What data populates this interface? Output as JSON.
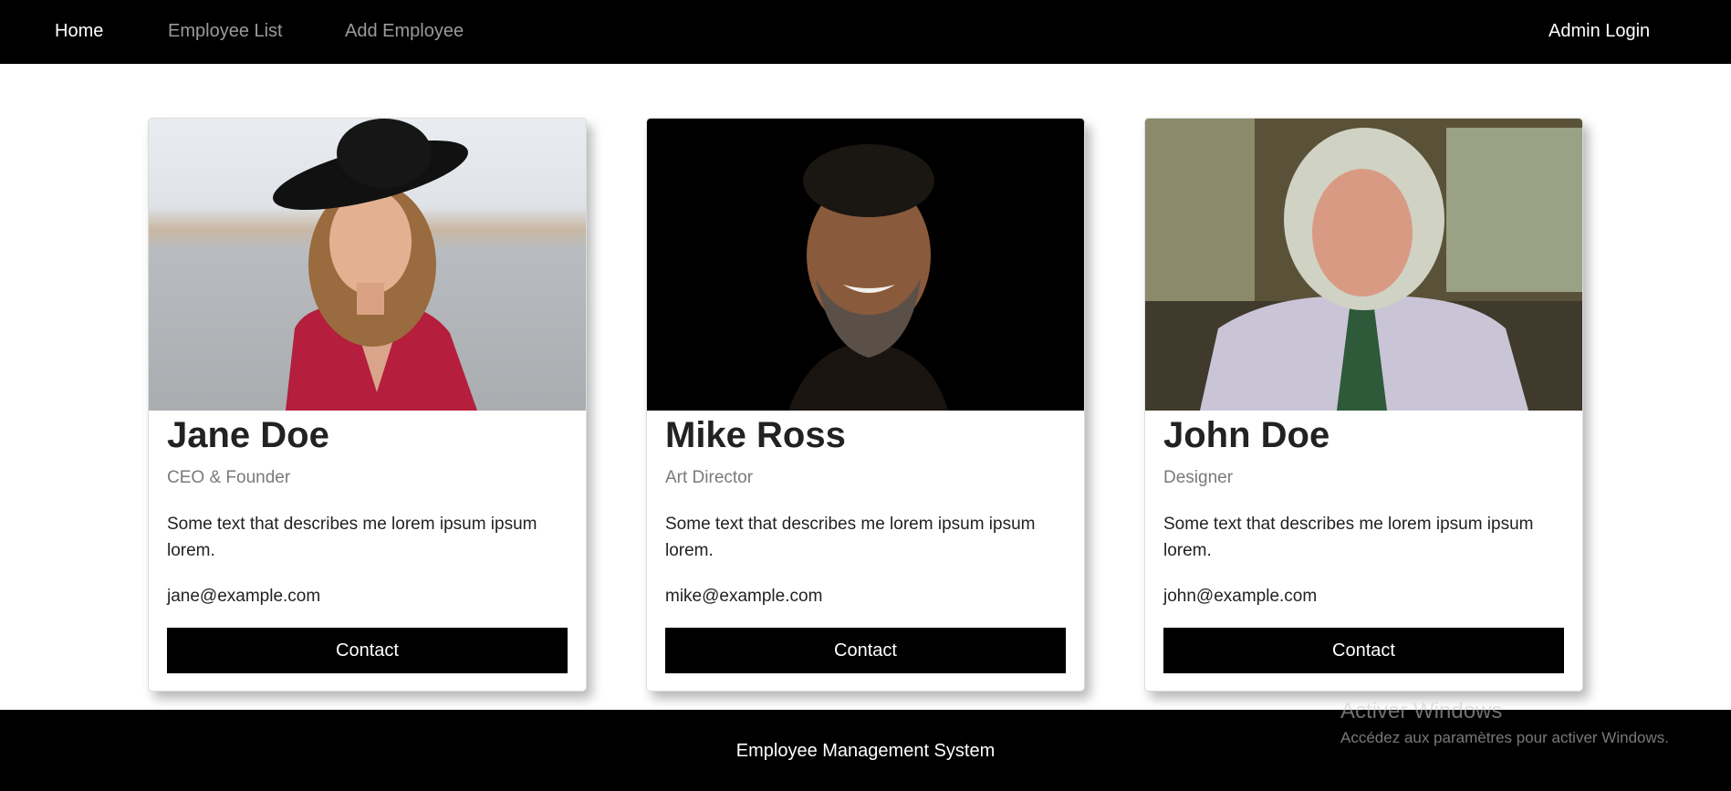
{
  "nav": {
    "home": "Home",
    "employee_list": "Employee List",
    "add_employee": "Add Employee",
    "admin_login": "Admin Login"
  },
  "employees": [
    {
      "name": "Jane Doe",
      "role": "CEO & Founder",
      "description": "Some text that describes me lorem ipsum ipsum lorem.",
      "email": "jane@example.com",
      "contact_label": "Contact"
    },
    {
      "name": "Mike Ross",
      "role": "Art Director",
      "description": "Some text that describes me lorem ipsum ipsum lorem.",
      "email": "mike@example.com",
      "contact_label": "Contact"
    },
    {
      "name": "John Doe",
      "role": "Designer",
      "description": "Some text that describes me lorem ipsum ipsum lorem.",
      "email": "john@example.com",
      "contact_label": "Contact"
    }
  ],
  "footer": {
    "text": "Employee Management System"
  },
  "watermark": {
    "title": "Activer Windows",
    "subtitle": "Accédez aux paramètres pour activer Windows."
  },
  "colors": {
    "navbar_bg": "#000000",
    "nav_active": "#ffffff",
    "nav_inactive": "#9a9a9a",
    "button_bg": "#000000",
    "footer_bg": "#000000"
  }
}
